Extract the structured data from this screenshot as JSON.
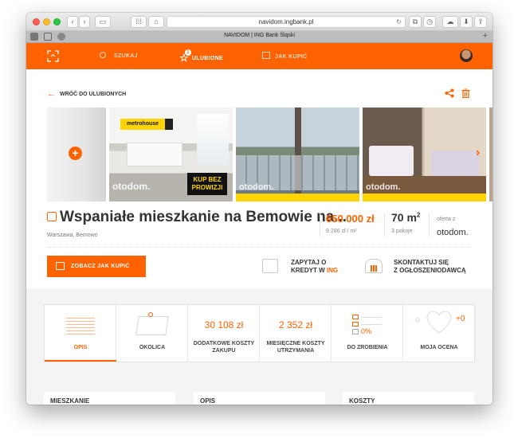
{
  "browser": {
    "url": "navidom.ingbank.pl",
    "tab_title": "NAVIDOM | ING Bank Śląski"
  },
  "nav": {
    "search": "SZUKAJ",
    "favorites": "ULUBIONE",
    "favorites_count": "1",
    "how_to_buy": "JAK KUPIĆ"
  },
  "page": {
    "back_label": "WRÓĆ DO ULUBIONYCH",
    "photo_badge_brand": "metrohouse",
    "photo_badge_line1": "KUP BEZ",
    "photo_badge_line2": "PROWIZJI",
    "watermark": "otodom.",
    "title": "Wspaniałe mieszkanie na Bemowie na...",
    "location": "Warszawa, Bemowo",
    "price": "650 000 zł",
    "price_per_m2": "9 286 zł / m²",
    "area_value": "70 m",
    "area_unit_sup": "2",
    "rooms": "3 pokoje",
    "offer_from": "oferta z",
    "offer_source": "otodom.",
    "cta_label": "ZOBACZ JAK KUPIĆ",
    "credit_line1": "ZAPYTAJ O",
    "credit_line2": "KREDYT W ",
    "credit_brand": "ING",
    "contact_line1": "SKONTAKTUJ SIĘ",
    "contact_line2": "Z OGŁOSZENIODAWCĄ"
  },
  "tiles": [
    {
      "label": "OPIS"
    },
    {
      "label": "OKOLICA"
    },
    {
      "value": "30 108 zł",
      "label": "DODATKOWE KOSZTY ZAKUPU"
    },
    {
      "value": "2 352 zł",
      "label": "MIESIĘCZNE KOSZTY UTRZYMANIA"
    },
    {
      "value": "0%",
      "label": "DO ZROBIENIA"
    },
    {
      "value_left": "-0",
      "value_right": "+0",
      "label": "MOJA OCENA"
    }
  ],
  "cards": [
    "MIESZKANIE",
    "OPIS",
    "KOSZTY"
  ],
  "colors": {
    "accent": "#ff6200"
  }
}
